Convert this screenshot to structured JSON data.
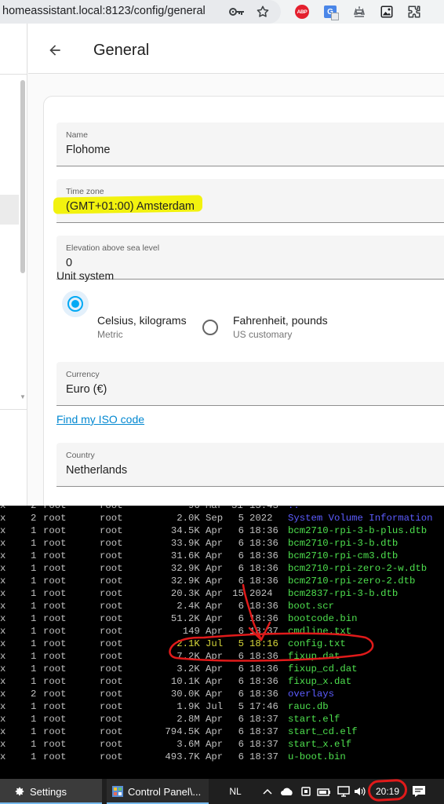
{
  "browser": {
    "url": "homeassistant.local:8123/config/general",
    "icons": [
      "key-icon",
      "star-icon",
      "adblock-plus-icon",
      "google-translate-icon",
      "scale-icon",
      "image-icon",
      "extensions-icon"
    ],
    "abp_label": "ABP",
    "gt_label": "G"
  },
  "page": {
    "title": "General",
    "fields": {
      "name": {
        "label": "Name",
        "value": "Flohome"
      },
      "time_zone": {
        "label": "Time zone",
        "value": "(GMT+01:00) Amsterdam"
      },
      "elevation": {
        "label": "Elevation above sea level",
        "value": "0"
      },
      "currency": {
        "label": "Currency",
        "value": "Euro (€)"
      },
      "country": {
        "label": "Country",
        "value": "Netherlands"
      }
    },
    "unit_system": {
      "title": "Unit system",
      "options": [
        {
          "label": "Celsius, kilograms",
          "sub": "Metric",
          "selected": true
        },
        {
          "label": "Fahrenheit, pounds",
          "sub": "US customary",
          "selected": false
        }
      ]
    },
    "iso_link": "Find my ISO code"
  },
  "terminal": {
    "rows": [
      {
        "perm": "x",
        "links": "2",
        "user": "root",
        "group": "root",
        "size": "2.0K",
        "month": "Sep",
        "day": "5",
        "time": "2022",
        "name": "System Volume Information",
        "color": "blue"
      },
      {
        "perm": "x",
        "links": "1",
        "user": "root",
        "group": "root",
        "size": "34.5K",
        "month": "Apr",
        "day": "6",
        "time": "18:36",
        "name": "bcm2710-rpi-3-b-plus.dtb",
        "color": "green"
      },
      {
        "perm": "x",
        "links": "1",
        "user": "root",
        "group": "root",
        "size": "33.9K",
        "month": "Apr",
        "day": "6",
        "time": "18:36",
        "name": "bcm2710-rpi-3-b.dtb",
        "color": "green"
      },
      {
        "perm": "x",
        "links": "1",
        "user": "root",
        "group": "root",
        "size": "31.6K",
        "month": "Apr",
        "day": "6",
        "time": "18:36",
        "name": "bcm2710-rpi-cm3.dtb",
        "color": "green"
      },
      {
        "perm": "x",
        "links": "1",
        "user": "root",
        "group": "root",
        "size": "32.9K",
        "month": "Apr",
        "day": "6",
        "time": "18:36",
        "name": "bcm2710-rpi-zero-2-w.dtb",
        "color": "green"
      },
      {
        "perm": "x",
        "links": "1",
        "user": "root",
        "group": "root",
        "size": "32.9K",
        "month": "Apr",
        "day": "6",
        "time": "18:36",
        "name": "bcm2710-rpi-zero-2.dtb",
        "color": "green"
      },
      {
        "perm": "x",
        "links": "1",
        "user": "root",
        "group": "root",
        "size": "20.3K",
        "month": "Apr",
        "day": "15",
        "time": "2024",
        "name": "bcm2837-rpi-3-b.dtb",
        "color": "green"
      },
      {
        "perm": "x",
        "links": "1",
        "user": "root",
        "group": "root",
        "size": "2.4K",
        "month": "Apr",
        "day": "6",
        "time": "18:36",
        "name": "boot.scr",
        "color": "green"
      },
      {
        "perm": "x",
        "links": "1",
        "user": "root",
        "group": "root",
        "size": "51.2K",
        "month": "Apr",
        "day": "6",
        "time": "18:36",
        "name": "bootcode.bin",
        "color": "green"
      },
      {
        "perm": "x",
        "links": "1",
        "user": "root",
        "group": "root",
        "size": "149",
        "month": "Apr",
        "day": "6",
        "time": "18:37",
        "name": "cmdline.txt",
        "color": "green"
      },
      {
        "perm": "x",
        "links": "1",
        "user": "root",
        "group": "root",
        "size": "2.1K",
        "month": "Jul",
        "day": "5",
        "time": "18:16",
        "name": "config.txt",
        "color": "green",
        "meta_color": "yellow"
      },
      {
        "perm": "x",
        "links": "1",
        "user": "root",
        "group": "root",
        "size": "7.2K",
        "month": "Apr",
        "day": "6",
        "time": "18:36",
        "name": "fixup.dat",
        "color": "green"
      },
      {
        "perm": "x",
        "links": "1",
        "user": "root",
        "group": "root",
        "size": "3.2K",
        "month": "Apr",
        "day": "6",
        "time": "18:36",
        "name": "fixup_cd.dat",
        "color": "green"
      },
      {
        "perm": "x",
        "links": "1",
        "user": "root",
        "group": "root",
        "size": "10.1K",
        "month": "Apr",
        "day": "6",
        "time": "18:36",
        "name": "fixup_x.dat",
        "color": "green"
      },
      {
        "perm": "x",
        "links": "2",
        "user": "root",
        "group": "root",
        "size": "30.0K",
        "month": "Apr",
        "day": "6",
        "time": "18:36",
        "name": "overlays",
        "color": "blue"
      },
      {
        "perm": "x",
        "links": "1",
        "user": "root",
        "group": "root",
        "size": "1.9K",
        "month": "Jul",
        "day": "5",
        "time": "17:46",
        "name": "rauc.db",
        "color": "green"
      },
      {
        "perm": "x",
        "links": "1",
        "user": "root",
        "group": "root",
        "size": "2.8M",
        "month": "Apr",
        "day": "6",
        "time": "18:37",
        "name": "start.elf",
        "color": "green"
      },
      {
        "perm": "x",
        "links": "1",
        "user": "root",
        "group": "root",
        "size": "794.5K",
        "month": "Apr",
        "day": "6",
        "time": "18:37",
        "name": "start_cd.elf",
        "color": "green"
      },
      {
        "perm": "x",
        "links": "1",
        "user": "root",
        "group": "root",
        "size": "3.6M",
        "month": "Apr",
        "day": "6",
        "time": "18:37",
        "name": "start_x.elf",
        "color": "green"
      },
      {
        "perm": "x",
        "links": "1",
        "user": "root",
        "group": "root",
        "size": "493.7K",
        "month": "Apr",
        "day": "6",
        "time": "18:37",
        "name": "u-boot.bin",
        "color": "green"
      }
    ],
    "colors": {
      "blue": "#5c5cff",
      "green": "#4ee04e",
      "yellow": "#d6d63a",
      "default": "#c0c0c0"
    }
  },
  "taskbar": {
    "settings_label": "Settings",
    "control_panel_label": "Control Panel\\...",
    "language": "NL",
    "clock": "20:19"
  },
  "annotations": {
    "highlight_color": "#f2f20e",
    "circle_color": "#e01a1a"
  }
}
